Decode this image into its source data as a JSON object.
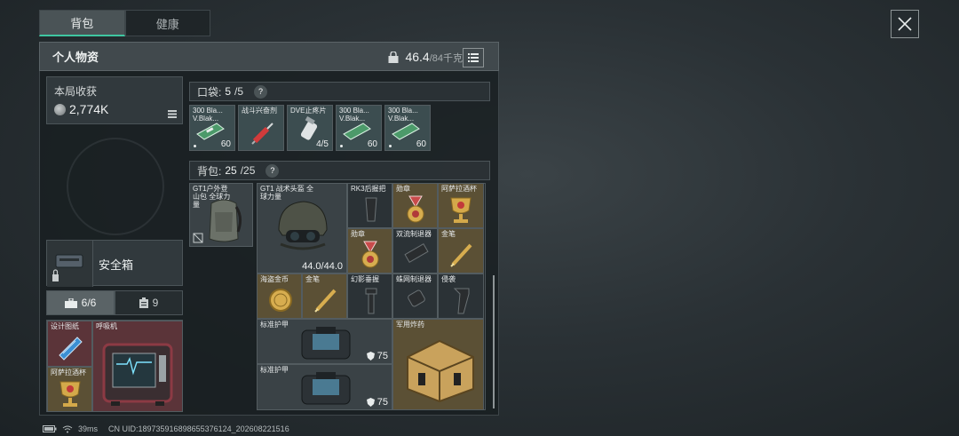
{
  "tabs": [
    {
      "label": "背包"
    },
    {
      "label": "健康"
    }
  ],
  "panel": {
    "title": "个人物资",
    "weight_current": "46.4",
    "weight_max": "/84千克"
  },
  "harvest": {
    "label": "本局收获",
    "value": "2,774K"
  },
  "safebox": {
    "label": "安全箱"
  },
  "subtabs": [
    {
      "label": "6/6"
    },
    {
      "label": "9"
    }
  ],
  "secure_items": [
    {
      "name": "设计图纸"
    },
    {
      "name": "呼吸机"
    },
    {
      "name": "阿萨拉酒杯"
    }
  ],
  "pocket": {
    "label": "口袋:",
    "count": "5",
    "max": "/5",
    "help": "?"
  },
  "pocket_items": [
    {
      "name": "300 Bla... V.Blak...",
      "qty": "60"
    },
    {
      "name": "战斗兴奋剂",
      "qty": ""
    },
    {
      "name": "DVE止疼片",
      "qty": "4/5"
    },
    {
      "name": "300 Bla... V.Blak...",
      "qty": "60"
    },
    {
      "name": "300 Bla... V.Blak...",
      "qty": "60"
    }
  ],
  "backpack": {
    "label": "背包:",
    "count": "25",
    "max": "/25",
    "help": "?"
  },
  "backpack_bag": {
    "name": "GT1户外登山包 全球力量"
  },
  "backpack_items": [
    {
      "name": "GT1 战术头盔 全球力量",
      "qty": "44.0/44.0"
    },
    {
      "name": "RK3后握把"
    },
    {
      "name": "勋章"
    },
    {
      "name": "阿萨拉酒杯"
    },
    {
      "name": "勋章"
    },
    {
      "name": "双流制退器"
    },
    {
      "name": "金笔"
    },
    {
      "name": "海盗金币"
    },
    {
      "name": "金笔"
    },
    {
      "name": "幻影垂握"
    },
    {
      "name": "蛛网制退器"
    },
    {
      "name": "侵袭"
    },
    {
      "name": "标准护甲",
      "qty": "75"
    },
    {
      "name": "军用炸药"
    },
    {
      "name": "标准护甲",
      "qty": "75"
    }
  ],
  "footer": {
    "ping": "39ms",
    "uid": "CN UID:18973591689865537612​4_202608221516"
  }
}
